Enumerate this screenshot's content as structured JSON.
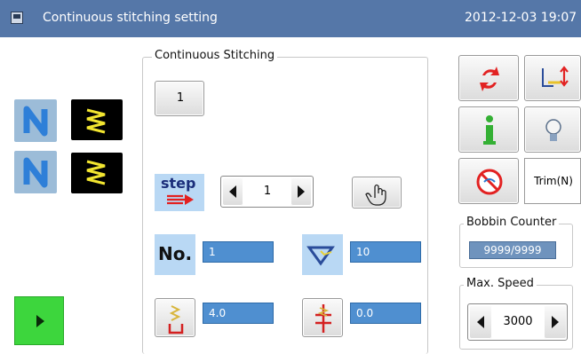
{
  "title_bar": {
    "title": "Continuous stitching setting",
    "datetime": "2012-12-03  19:07"
  },
  "continuous": {
    "legend": "Continuous Stitching",
    "pattern_no": "1",
    "step_label": "step",
    "step_value": "1",
    "no_label": "No.",
    "no_value": "1",
    "tension_value": "10",
    "stitch_length_value": "4.0",
    "needle_value": "0.0"
  },
  "right_panel": {
    "trim_label": "Trim(N)",
    "bobbin_legend": "Bobbin Counter",
    "bobbin_value": "9999/9999",
    "speed_legend": "Max. Speed",
    "speed_value": "3000"
  },
  "colors": {
    "title_bg": "#5577a8",
    "field_bg": "#4f8fd0",
    "start_green": "#3dd63d"
  }
}
